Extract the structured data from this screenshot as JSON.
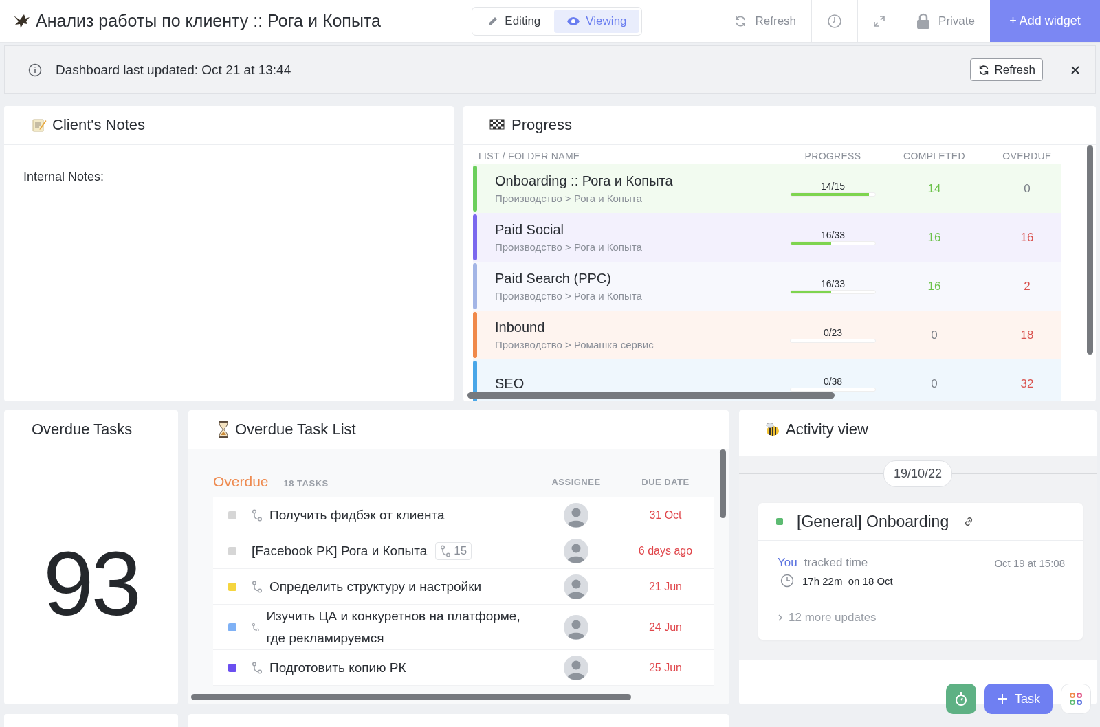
{
  "header": {
    "title": "Анализ работы по клиенту :: Рога и Копыта",
    "mode_tabs": [
      {
        "label": "Editing",
        "selected": false
      },
      {
        "label": "Viewing",
        "selected": true
      }
    ],
    "refresh": "Refresh",
    "privacy": "Private",
    "add_widget": "+ Add widget"
  },
  "banner": {
    "text": "Dashboard last updated: Oct 21 at 13:44",
    "button": "Refresh"
  },
  "notes_widget": {
    "title": "Client's Notes",
    "label": "Internal Notes:"
  },
  "progress_widget": {
    "title": "Progress",
    "columns": [
      "LIST / FOLDER NAME",
      "PROGRESS",
      "COMPLETED",
      "OVERDUE"
    ],
    "rows": [
      {
        "name": "Onboarding :: Рога и Копыта",
        "path": "Производство > Рога и Копыта",
        "color": "#6ccf5c",
        "ratio": "14/15",
        "level": 0.93,
        "completed": "14",
        "overdue": "0"
      },
      {
        "name": "Paid Social",
        "path": "Производство > Рога и Копыта",
        "color": "#7b68ee",
        "ratio": "16/33",
        "level": 0.48,
        "completed": "16",
        "overdue": "16"
      },
      {
        "name": "Paid Search (PPC)",
        "path": "Производство > Рога и Копыта",
        "color": "#a3b5e6",
        "ratio": "16/33",
        "level": 0.48,
        "completed": "16",
        "overdue": "2"
      },
      {
        "name": "Inbound",
        "path": "Производство > Ромашка сервис",
        "color": "#f0894a",
        "ratio": "0/23",
        "level": 0,
        "completed": "0",
        "overdue": "18"
      },
      {
        "name": "SEO",
        "color": "#4aa7e8",
        "ratio": "0/38",
        "level": 0,
        "completed": "0",
        "overdue": "32"
      }
    ]
  },
  "overdue_count_widget": {
    "title": "Overdue Tasks",
    "value": "93"
  },
  "task_list_widget": {
    "title": "Overdue Task List",
    "group": "Overdue",
    "count": "18 TASKS",
    "columns": [
      "ASSIGNEE",
      "DUE DATE"
    ],
    "tasks": [
      {
        "kind": "subtask",
        "name": "Получить фидбэк от клиента",
        "color": "#d6d6d6",
        "due": "31 Oct"
      },
      {
        "kind": "parent",
        "name": "[Facebook PK] Рога и Копыта",
        "subtasks": "15",
        "color": "#d6d6d6",
        "due": "6 days ago"
      },
      {
        "kind": "subtask",
        "name": "Определить структуру и настройки",
        "color": "#f5d53f",
        "due": "21 Jun"
      },
      {
        "kind": "subtask",
        "name": "Изучить ЦА и конкуретнов на платформе, где рекламируемся",
        "color": "#7fb1f5",
        "due": "24 Jun"
      },
      {
        "kind": "subtask",
        "name": "Подготовить копию РК",
        "color": "#6b4ff0",
        "due": "25 Jun"
      }
    ]
  },
  "activity_widget": {
    "title": "Activity view",
    "date": "19/10/22",
    "card": {
      "title": "[General] Onboarding",
      "color": "#5dbb72",
      "actor": "You",
      "action": "tracked time",
      "time": "Oct 19 at 15:08",
      "duration": "17h 22m  on 18 Oct",
      "more": "12 more updates"
    }
  },
  "floating": {
    "task_button": "Task"
  }
}
